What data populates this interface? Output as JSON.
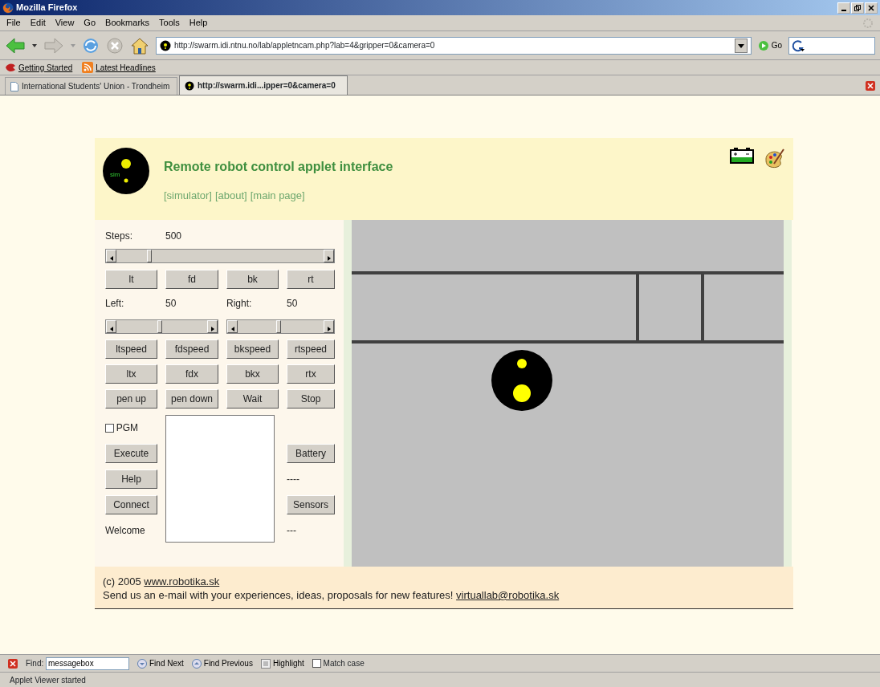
{
  "browser": {
    "title": "Mozilla Firefox",
    "menu": [
      "File",
      "Edit",
      "View",
      "Go",
      "Bookmarks",
      "Tools",
      "Help"
    ],
    "url": "http://swarm.idi.ntnu.no/lab/appletncam.php?lab=4&gripper=0&camera=0",
    "go_label": "Go",
    "bookmarks": [
      "Getting Started",
      "Latest Headlines"
    ],
    "tabs": [
      {
        "label": "International Students' Union - Trondheim",
        "selected": false
      },
      {
        "label": "http://swarm.idi...ipper=0&camera=0",
        "selected": true
      }
    ]
  },
  "applet": {
    "title": "Remote robot control applet interface",
    "logo_text": "sim",
    "links": [
      "[simulator]",
      "[about]",
      "[main page]"
    ],
    "steps": {
      "label": "Steps:",
      "value": "500",
      "level": 0.17
    },
    "move_buttons": [
      "lt",
      "fd",
      "bk",
      "rt"
    ],
    "left": {
      "label": "Left:",
      "value": "50",
      "level": 0.5
    },
    "right": {
      "label": "Right:",
      "value": "50",
      "level": 0.5
    },
    "button_rows": [
      [
        "ltspeed",
        "fdspeed",
        "bkspeed",
        "rtspeed"
      ],
      [
        "ltx",
        "fdx",
        "bkx",
        "rtx"
      ],
      [
        "pen up",
        "pen down",
        "Wait",
        "Stop"
      ]
    ],
    "pgm": {
      "label": "PGM",
      "checked": false
    },
    "left_buttons": [
      "Execute",
      "Help",
      "Connect"
    ],
    "welcome": "Welcome",
    "battery_button": "Battery",
    "battery_reading": "----",
    "sensors_button": "Sensors",
    "sensors_reading": "---"
  },
  "footer": {
    "copyright": "(c) 2005",
    "site_link": "www.robotika.sk",
    "message": "Send us an e-mail with your experiences, ideas, proposals for new features!",
    "email": "virtuallab@robotika.sk"
  },
  "find_bar": {
    "label": "Find:",
    "value": "messagebox",
    "buttons": [
      "Find Next",
      "Find Previous",
      "Highlight"
    ],
    "match_case": {
      "label": "Match case",
      "checked": false
    }
  },
  "status_bar": "Applet Viewer started"
}
